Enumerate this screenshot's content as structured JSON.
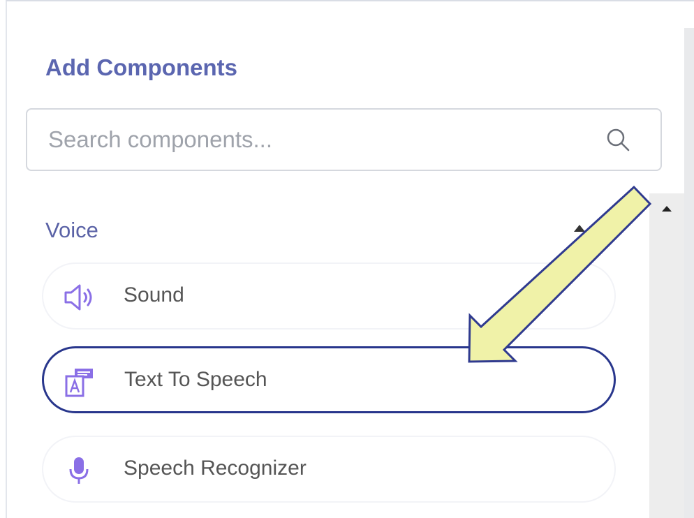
{
  "panel": {
    "title": "Add Components"
  },
  "search": {
    "placeholder": "Search components..."
  },
  "section": {
    "title": "Voice",
    "items": [
      {
        "label": "Sound",
        "icon": "speaker-icon",
        "selected": false
      },
      {
        "label": "Text To Speech",
        "icon": "text-to-speech-icon",
        "selected": true
      },
      {
        "label": "Speech Recognizer",
        "icon": "microphone-icon",
        "selected": false
      }
    ]
  },
  "colors": {
    "accent": "#5b66b0",
    "icon": "#8a6fe6",
    "selected_outline": "#28368c",
    "annotation_arrow_fill": "#f0f2a8",
    "annotation_arrow_stroke": "#2f3a8f"
  }
}
